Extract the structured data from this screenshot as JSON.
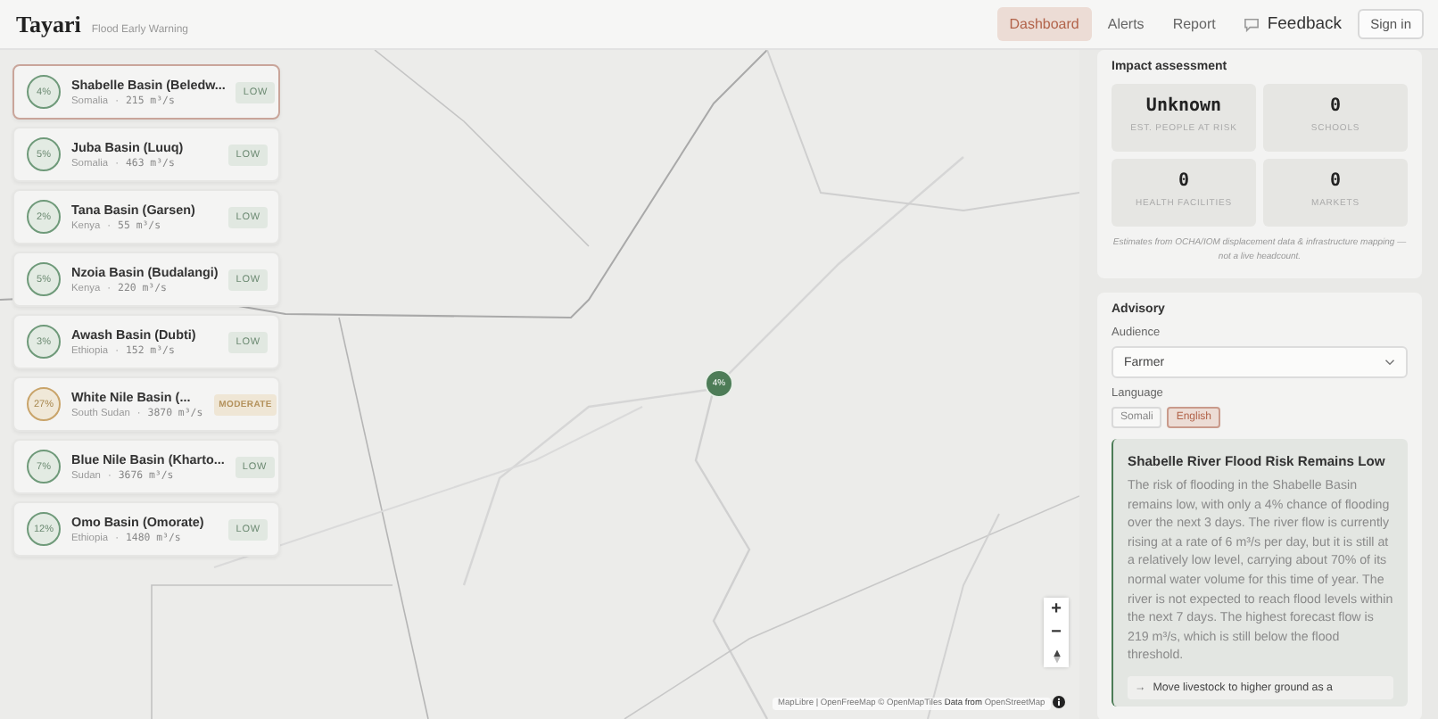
{
  "header": {
    "logo": "Tayari",
    "subtitle": "Flood Early Warning",
    "nav": [
      {
        "label": "Dashboard",
        "selected": true
      },
      {
        "label": "Alerts",
        "selected": false
      },
      {
        "label": "Report",
        "selected": false
      }
    ],
    "feedback": "Feedback",
    "sign_in": "Sign in"
  },
  "basins": [
    {
      "name": "Shabelle Basin (Beledw...",
      "country": "Somalia",
      "separator": "·",
      "flow": "215 m³/s",
      "chance": "4%",
      "risk": "LOW",
      "kind": "low",
      "selected": true
    },
    {
      "name": "Juba Basin (Luuq)",
      "country": "Somalia",
      "separator": "·",
      "flow": "463 m³/s",
      "chance": "5%",
      "risk": "LOW",
      "kind": "low",
      "selected": false
    },
    {
      "name": "Tana Basin (Garsen)",
      "country": "Kenya",
      "separator": "·",
      "flow": "55 m³/s",
      "chance": "2%",
      "risk": "LOW",
      "kind": "low",
      "selected": false
    },
    {
      "name": "Nzoia Basin (Budalangi)",
      "country": "Kenya",
      "separator": "·",
      "flow": "220 m³/s",
      "chance": "5%",
      "risk": "LOW",
      "kind": "low",
      "selected": false
    },
    {
      "name": "Awash Basin (Dubti)",
      "country": "Ethiopia",
      "separator": "·",
      "flow": "152 m³/s",
      "chance": "3%",
      "risk": "LOW",
      "kind": "low",
      "selected": false
    },
    {
      "name": "White Nile Basin (...",
      "country": "South Sudan",
      "separator": "·",
      "flow": "3870 m³/s",
      "chance": "27%",
      "risk": "MODERATE",
      "kind": "moderate",
      "selected": false
    },
    {
      "name": "Blue Nile Basin (Kharto...",
      "country": "Sudan",
      "separator": "·",
      "flow": "3676 m³/s",
      "chance": "7%",
      "risk": "LOW",
      "kind": "low",
      "selected": false
    },
    {
      "name": "Omo Basin (Omorate)",
      "country": "Ethiopia",
      "separator": "·",
      "flow": "1480 m³/s",
      "chance": "12%",
      "risk": "LOW",
      "kind": "low",
      "selected": false
    }
  ],
  "map": {
    "marker": "4%",
    "zoom_in": "+",
    "zoom_out": "−",
    "attribution": "MapLibre | OpenFreeMap © OpenMapTiles",
    "attribution_data": "Data from",
    "attribution_source": "OpenStreetMap"
  },
  "impact": {
    "title": "Impact assessment",
    "stats": [
      {
        "value": "Unknown",
        "label": "EST. PEOPLE AT RISK"
      },
      {
        "value": "0",
        "label": "SCHOOLS"
      },
      {
        "value": "0",
        "label": "HEALTH FACILITIES"
      },
      {
        "value": "0",
        "label": "MARKETS"
      }
    ],
    "note": "Estimates from OCHA/IOM displacement data & infrastructure mapping — not a live headcount."
  },
  "advisory": {
    "title": "Advisory",
    "audience_label": "Audience",
    "audience": "Farmer",
    "language_label": "Language",
    "languages": [
      {
        "label": "Somali",
        "selected": false
      },
      {
        "label": "English",
        "selected": true
      }
    ],
    "headline": "Shabelle River Flood Risk Remains Low",
    "body": "The risk of flooding in the Shabelle Basin remains low, with only a 4% chance of flooding over the next 3 days. The river flow is currently rising at a rate of 6 m³/s per day, but it is still at a relatively low level, carrying about 70% of its normal water volume for this time of year. The river is not expected to reach flood levels within the next 7 days. The highest forecast flow is 219 m³/s, which is still below the flood threshold.",
    "actions": [
      {
        "icon": "→",
        "text": "Move livestock to higher ground as a"
      }
    ]
  }
}
